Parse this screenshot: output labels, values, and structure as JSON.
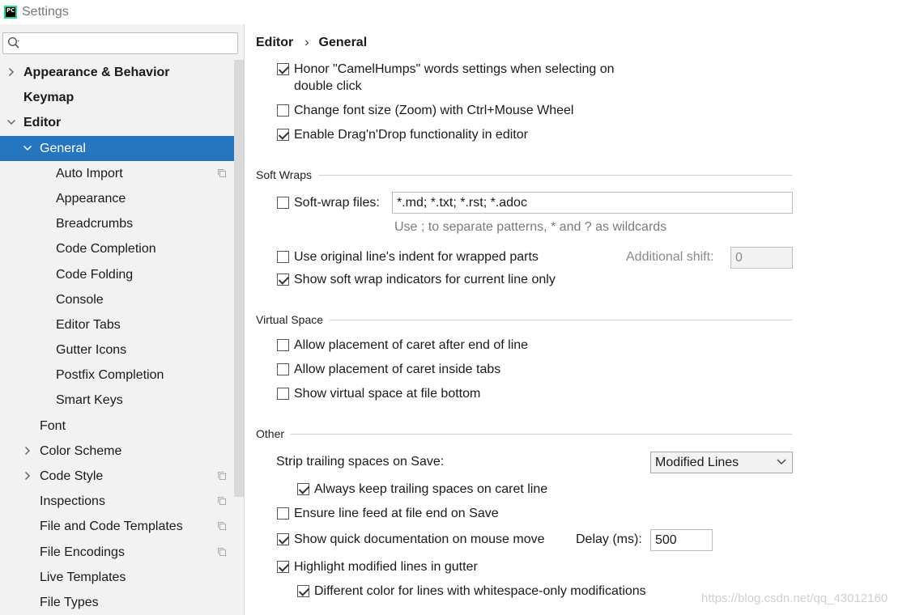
{
  "window": {
    "title": "Settings"
  },
  "sidebar": {
    "items": [
      {
        "label": "Appearance & Behavior",
        "level": 0,
        "bold": true,
        "arrow": "right"
      },
      {
        "label": "Keymap",
        "level": 0,
        "bold": true,
        "arrow": ""
      },
      {
        "label": "Editor",
        "level": 0,
        "bold": true,
        "arrow": "down"
      },
      {
        "label": "General",
        "level": 1,
        "bold": false,
        "arrow": "down",
        "selected": true
      },
      {
        "label": "Auto Import",
        "level": 2,
        "bold": false,
        "arrow": "",
        "copy": true
      },
      {
        "label": "Appearance",
        "level": 2,
        "bold": false,
        "arrow": ""
      },
      {
        "label": "Breadcrumbs",
        "level": 2,
        "bold": false,
        "arrow": ""
      },
      {
        "label": "Code Completion",
        "level": 2,
        "bold": false,
        "arrow": ""
      },
      {
        "label": "Code Folding",
        "level": 2,
        "bold": false,
        "arrow": ""
      },
      {
        "label": "Console",
        "level": 2,
        "bold": false,
        "arrow": ""
      },
      {
        "label": "Editor Tabs",
        "level": 2,
        "bold": false,
        "arrow": ""
      },
      {
        "label": "Gutter Icons",
        "level": 2,
        "bold": false,
        "arrow": ""
      },
      {
        "label": "Postfix Completion",
        "level": 2,
        "bold": false,
        "arrow": ""
      },
      {
        "label": "Smart Keys",
        "level": 2,
        "bold": false,
        "arrow": ""
      },
      {
        "label": "Font",
        "level": 1,
        "bold": false,
        "arrow": ""
      },
      {
        "label": "Color Scheme",
        "level": 1,
        "bold": false,
        "arrow": "right"
      },
      {
        "label": "Code Style",
        "level": 1,
        "bold": false,
        "arrow": "right",
        "copy": true
      },
      {
        "label": "Inspections",
        "level": 1,
        "bold": false,
        "arrow": "",
        "copy": true
      },
      {
        "label": "File and Code Templates",
        "level": 1,
        "bold": false,
        "arrow": "",
        "copy": true
      },
      {
        "label": "File Encodings",
        "level": 1,
        "bold": false,
        "arrow": "",
        "copy": true
      },
      {
        "label": "Live Templates",
        "level": 1,
        "bold": false,
        "arrow": ""
      },
      {
        "label": "File Types",
        "level": 1,
        "bold": false,
        "arrow": ""
      }
    ]
  },
  "breadcrumb": {
    "parent": "Editor",
    "separator": "›",
    "current": "General"
  },
  "top_options": {
    "camelhumps": {
      "label": "Honor \"CamelHumps\" words settings when selecting on",
      "label_line2": "double click",
      "checked": true
    },
    "zoom": {
      "label": "Change font size (Zoom) with Ctrl+Mouse Wheel",
      "checked": false
    },
    "dragdrop": {
      "label": "Enable Drag'n'Drop functionality in editor",
      "checked": true
    }
  },
  "soft_wraps": {
    "title": "Soft Wraps",
    "softwrap_files": {
      "label": "Soft-wrap files:",
      "checked": false,
      "value": "*.md; *.txt; *.rst; *.adoc"
    },
    "hint": "Use ; to separate patterns, * and ? as wildcards",
    "original_indent": {
      "label": "Use original line's indent for wrapped parts",
      "checked": false
    },
    "additional_shift": {
      "label": "Additional shift:",
      "value": "0"
    },
    "indicators": {
      "label": "Show soft wrap indicators for current line only",
      "checked": true
    }
  },
  "virtual_space": {
    "title": "Virtual Space",
    "after_eol": {
      "label": "Allow placement of caret after end of line",
      "checked": false
    },
    "inside_tabs": {
      "label": "Allow placement of caret inside tabs",
      "checked": false
    },
    "file_bottom": {
      "label": "Show virtual space at file bottom",
      "checked": false
    }
  },
  "other": {
    "title": "Other",
    "strip_label": "Strip trailing spaces on Save:",
    "strip_value": "Modified Lines",
    "keep_caret": {
      "label": "Always keep trailing spaces on caret line",
      "checked": true
    },
    "line_feed": {
      "label": "Ensure line feed at file end on Save",
      "checked": false
    },
    "quick_doc": {
      "label": "Show quick documentation on mouse move",
      "checked": true
    },
    "delay_label": "Delay (ms):",
    "delay_value": "500",
    "highlight_modified": {
      "label": "Highlight modified lines in gutter",
      "checked": true
    },
    "whitespace_color": {
      "label": "Different color for lines with whitespace-only modifications",
      "checked": true
    }
  },
  "watermark": "https://blog.csdn.net/qq_43012160",
  "icons": {
    "app_logo": "pycharm-logo-icon",
    "search": "search-icon",
    "expand": "chevron-right-icon",
    "collapse": "chevron-down-icon",
    "project_settings": "copy-icon",
    "dropdown": "chevron-down-icon"
  },
  "colors": {
    "selection": "#2675bf",
    "sidebar_bg": "#f2f2f2"
  }
}
